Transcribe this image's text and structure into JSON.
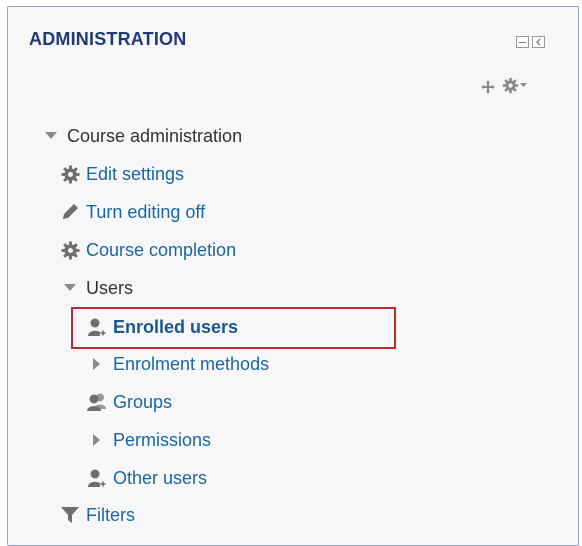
{
  "block": {
    "title": "ADMINISTRATION",
    "controls": [
      "minimize-icon",
      "dock-icon",
      "move-icon",
      "gear-menu-icon"
    ]
  },
  "tree": {
    "course_admin": "Course administration",
    "edit_settings": "Edit settings",
    "turn_editing_off": "Turn editing off",
    "course_completion": "Course completion",
    "users": "Users",
    "enrolled_users": "Enrolled users",
    "enrolment_methods": "Enrolment methods",
    "groups": "Groups",
    "permissions": "Permissions",
    "other_users": "Other users",
    "filters": "Filters"
  },
  "colors": {
    "link": "#1a66a3",
    "highlight": "#c0282d",
    "title": "#1e3a78"
  }
}
